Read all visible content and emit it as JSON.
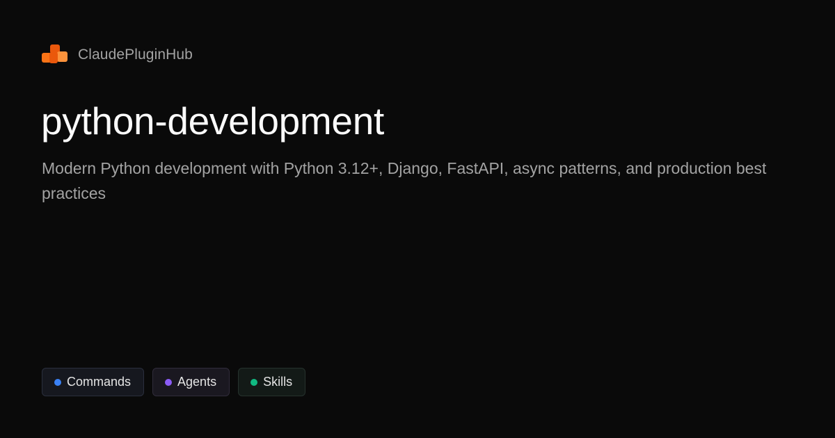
{
  "brand": {
    "name": "ClaudePluginHub",
    "logo_icon": "stacked-blocks-icon",
    "logo_colors": [
      "#ea580c",
      "#fb923c",
      "#f97316"
    ]
  },
  "plugin": {
    "title": "python-development",
    "description": "Modern Python development with Python 3.12+, Django, FastAPI, async patterns, and production best practices"
  },
  "tags": [
    {
      "label": "Commands",
      "dot_color": "#3b82f6"
    },
    {
      "label": "Agents",
      "dot_color": "#8b5cf6"
    },
    {
      "label": "Skills",
      "dot_color": "#10b981"
    }
  ],
  "theme": {
    "background": "#0a0a0a",
    "title_color": "#fafafa",
    "muted_text": "#a3a3a3"
  }
}
